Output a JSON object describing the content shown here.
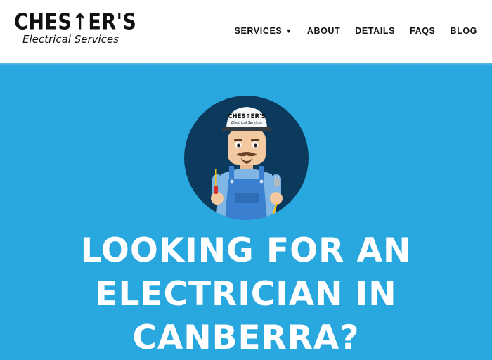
{
  "brand": {
    "name": "CHES↑ER'S",
    "tagline": "Electrical Services",
    "colors": {
      "accent": "#29a8e0",
      "navy": "#0b3a5c",
      "text": "#111111"
    }
  },
  "nav": {
    "items": [
      {
        "label": "SERVICES",
        "has_dropdown": true,
        "icon": "caret-down-icon"
      },
      {
        "label": "ABOUT"
      },
      {
        "label": "DETAILS"
      },
      {
        "label": "FAQS"
      },
      {
        "label": "BLOG"
      }
    ]
  },
  "hero": {
    "mascot_cap_text": "CHES↑ER'S",
    "mascot_cap_sub": "Electrical Services",
    "title_lines": [
      "LOOKING FOR AN",
      "ELECTRICIAN IN",
      "CANBERRA?"
    ]
  }
}
